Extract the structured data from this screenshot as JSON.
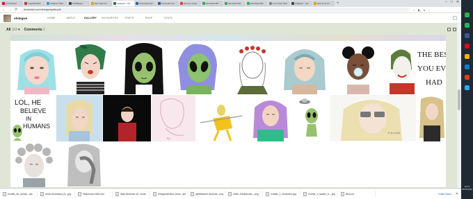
{
  "browser": {
    "tabs": [
      {
        "title": "(2) Pinterest",
        "color": "#e60023"
      },
      {
        "title": "Cape&Chains",
        "color": "#c0392b"
      },
      {
        "title": "Telegram Web",
        "color": "#2aa1da"
      },
      {
        "title": "TechBeginn",
        "color": "#444444"
      },
      {
        "title": "Seni Seni Pin",
        "color": "#e6a700"
      },
      {
        "title": "ofelegwe - Her",
        "color": "#1b7a3a",
        "active": true
      },
      {
        "title": "Photoshop Acu",
        "color": "#2b5fa8"
      },
      {
        "title": "Procreate Acu",
        "color": "#2b5fa8"
      },
      {
        "title": "Ha tout couple",
        "color": "#e04040"
      },
      {
        "title": "Zerodesk Whi",
        "color": "#2bb34a"
      },
      {
        "title": "Zerodesk Whi",
        "color": "#2bb34a"
      },
      {
        "title": "Zerodesk Whi",
        "color": "#2bb34a"
      },
      {
        "title": "Lynn Unkn Rich",
        "color": "#888888"
      },
      {
        "title": "Chapters - Jan",
        "color": "#444444"
      },
      {
        "title": "Seni Tony Art",
        "color": "#e6a700"
      }
    ],
    "new_tab": "+",
    "url": "deviantart.com/ofelegwe/gallery/all",
    "nav_back": "←",
    "nav_forward": "→",
    "nav_reload": "⟳"
  },
  "site": {
    "username": "ofelegwe",
    "nav": [
      {
        "label": "HOME"
      },
      {
        "label": "ABOUT"
      },
      {
        "label": "GALLERY",
        "selected": true
      },
      {
        "label": "FAVOURITES"
      },
      {
        "label": "POSTS"
      },
      {
        "label": "SHOP"
      },
      {
        "label": "STATS"
      }
    ]
  },
  "filter": {
    "all_label": "All",
    "all_count": "119",
    "comments_label": "Comments",
    "comments_count": "2"
  },
  "gallery": {
    "caption_1": "fbf.",
    "caption_2": "P A LUZA"
  },
  "downloads": {
    "files": [
      "Irvahle_be_sessio...ipk",
      "show-download (2)...jpg",
      "Watercolor-Mixi.ium",
      "Wall-Sketcher-M...brush",
      "Designelement_Brus...abr",
      "apfelbaume Animals...png",
      "0080--Earthbrows...png",
      "Irvahle_2_Summers.jpg",
      "Irvahle_2_ladder_b....jpg",
      "Brus.txt"
    ],
    "show_all": "Exibir todos",
    "close": "✕"
  },
  "system": {
    "time": "18:13",
    "date": "09/05/2020"
  }
}
